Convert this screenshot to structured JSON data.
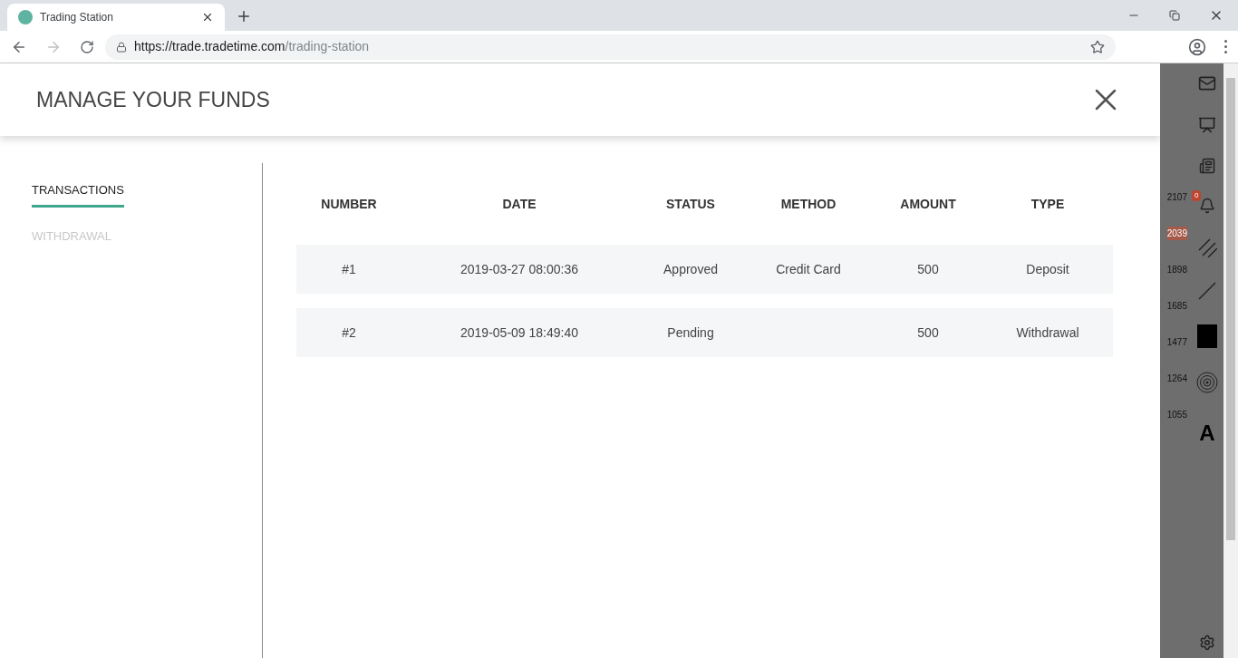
{
  "browser": {
    "tab_title": "Trading Station",
    "url_host": "https://trade.tradetime.com",
    "url_path": "/trading-station"
  },
  "background_app": {
    "price_levels": [
      {
        "value": "2107",
        "highlighted": false
      },
      {
        "value": "2039",
        "highlighted": true
      },
      {
        "value": "1898",
        "highlighted": false
      },
      {
        "value": "1685",
        "highlighted": false
      },
      {
        "value": "1477",
        "highlighted": false
      },
      {
        "value": "1264",
        "highlighted": false
      },
      {
        "value": "1055",
        "highlighted": false
      }
    ],
    "notification_count": "0",
    "text_tool": "A"
  },
  "modal": {
    "title": "MANAGE YOUR FUNDS",
    "nav": [
      {
        "label": "TRANSACTIONS",
        "selected": true
      },
      {
        "label": "WITHDRAWAL",
        "selected": false
      }
    ],
    "table": {
      "columns": [
        "NUMBER",
        "DATE",
        "STATUS",
        "METHOD",
        "AMOUNT",
        "TYPE"
      ],
      "rows": [
        [
          "#1",
          "2019-03-27 08:00:36",
          "Approved",
          "Credit Card",
          "500",
          "Deposit"
        ],
        [
          "#2",
          "2019-05-09 18:49:40",
          "Pending",
          "",
          "500",
          "Withdrawal"
        ]
      ]
    }
  }
}
